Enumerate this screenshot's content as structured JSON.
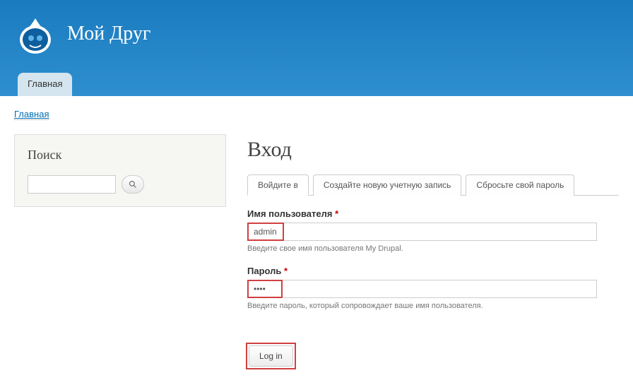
{
  "header": {
    "site_name": "Мой Друг"
  },
  "nav": {
    "home_tab": "Главная"
  },
  "breadcrumb": {
    "home": "Главная"
  },
  "sidebar": {
    "search_heading": "Поиск",
    "search_value": ""
  },
  "main": {
    "page_title": "Вход",
    "tabs": {
      "login": "Войдите в",
      "register": "Создайте новую учетную запись",
      "reset": "Сбросьте свой пароль"
    },
    "form": {
      "username_label": "Имя пользователя",
      "username_value": "admin",
      "username_help": "Введите свое имя пользователя My Drupal.",
      "password_label": "Пароль",
      "password_value": "....",
      "password_help": "Введите пароль, который сопровождает ваше имя пользователя.",
      "submit_label": "Log in",
      "required_marker": "*"
    }
  }
}
